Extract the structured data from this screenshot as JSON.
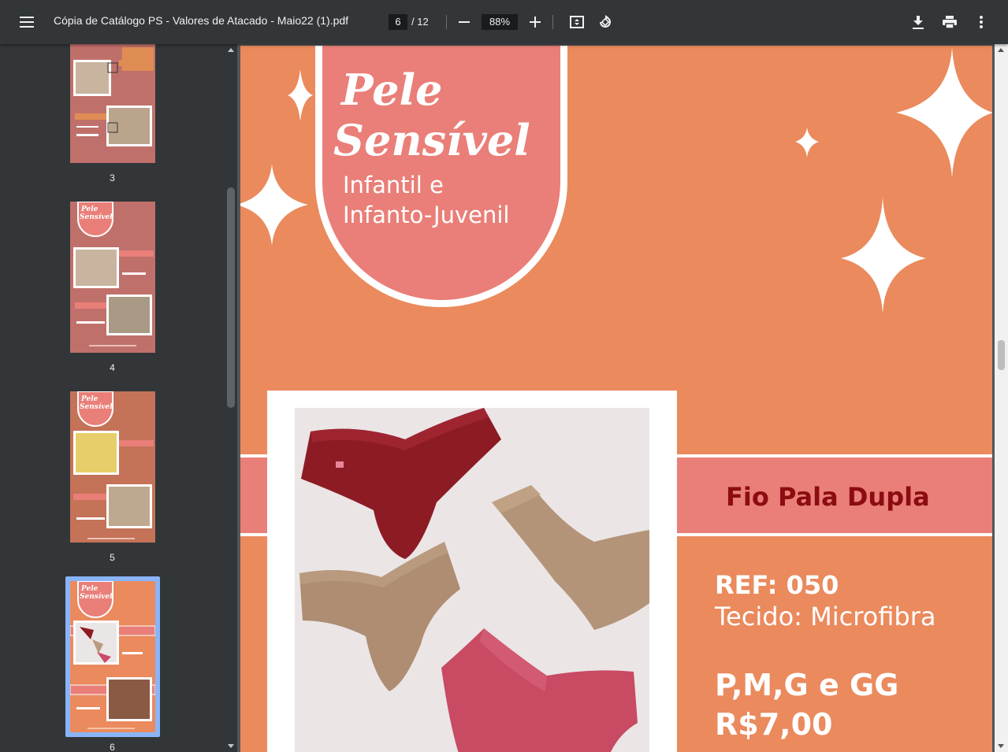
{
  "toolbar": {
    "title": "Cópia de Catálogo PS - Valores de Atacado - Maio22 (1).pdf",
    "current_page": "6",
    "total_pages": "/ 12",
    "zoom": "88%"
  },
  "sidebar": {
    "thumbnails": [
      {
        "label": "3"
      },
      {
        "label": "4"
      },
      {
        "label": "5"
      },
      {
        "label": "6",
        "selected": true
      }
    ]
  },
  "page": {
    "brand_line1": "Pele",
    "brand_line2": "Sensível",
    "subtitle_line1": "Infantil e",
    "subtitle_line2": "Infanto-Juvenil",
    "product_name": "Fio Pala Dupla",
    "ref": "REF: 050",
    "fabric": "Tecido: Microfibra",
    "sizes": "P,M,G e GG",
    "price": "R$7,00"
  },
  "colors": {
    "toolbar": "#323639",
    "page_bg": "#ea8a5d",
    "accent_pink": "#e97f78",
    "product_name": "#8c0c12",
    "selected_thumb": "#8ab4f8"
  },
  "icons": [
    "menu-icon",
    "zoom-out-icon",
    "zoom-in-icon",
    "fit-page-icon",
    "rotate-icon",
    "download-icon",
    "print-icon",
    "more-vert-icon"
  ]
}
